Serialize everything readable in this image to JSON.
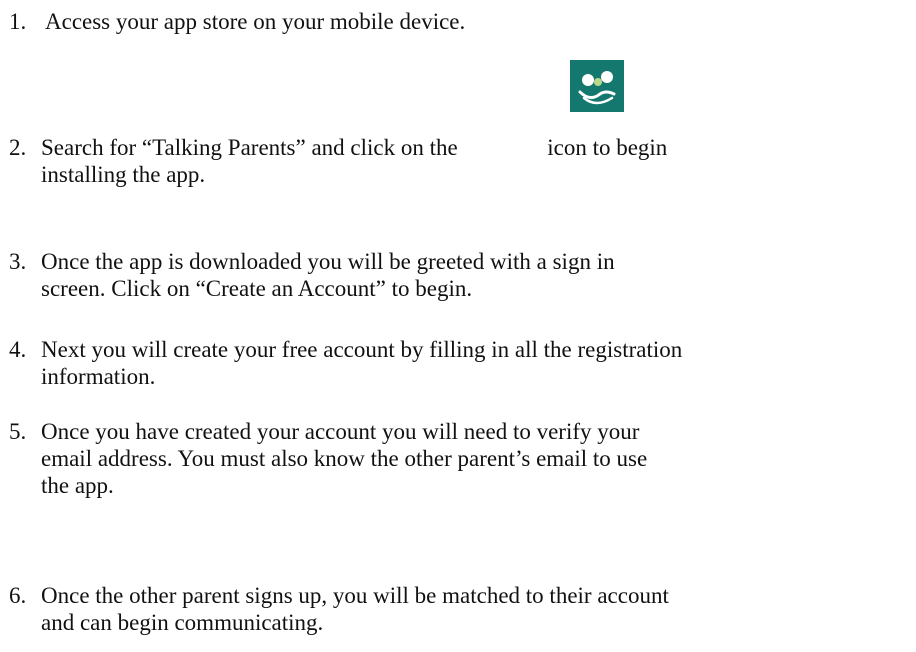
{
  "steps": [
    {
      "number": "1.",
      "lines": [
        "Access your app store on your mobile device."
      ]
    },
    {
      "number": "2.",
      "lines": [
        "Search for “Talking Parents” and click on the",
        "installing the app."
      ],
      "inline_tail": "icon to begin"
    },
    {
      "number": "3.",
      "lines": [
        "Once the app is downloaded you will be greeted with a sign in",
        "screen.  Click on “Create an Account” to begin."
      ]
    },
    {
      "number": "4.",
      "lines": [
        "Next you will create your free account by filling in all the registration",
        "information."
      ]
    },
    {
      "number": "5.",
      "lines": [
        "Once you have created your account you will need to verify your",
        "email address.  You must also know the other parent’s email to use",
        "the app."
      ]
    },
    {
      "number": "6.",
      "lines": [
        "Once the other parent signs up, you will be matched to their account",
        "and can begin communicating."
      ]
    }
  ],
  "app_icon": {
    "name": "talking-parents-app-icon",
    "color": "#14786f"
  }
}
